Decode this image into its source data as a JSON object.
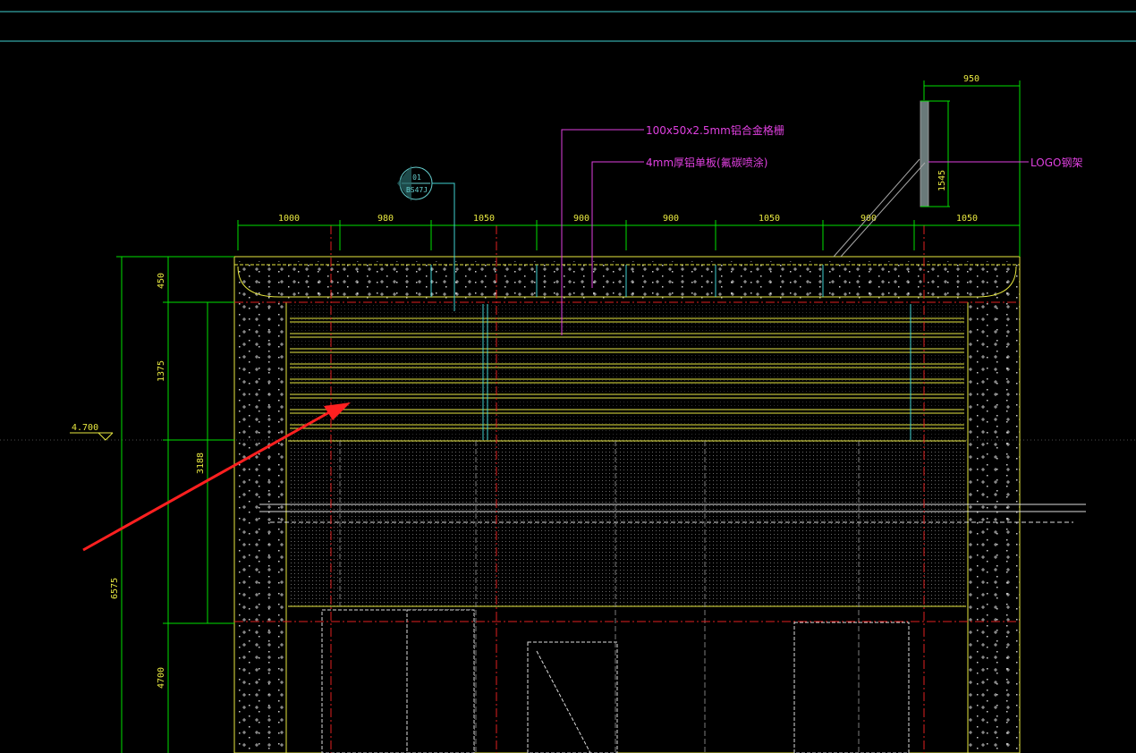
{
  "colors": {
    "background": "#000000",
    "dimension": "#00e000",
    "outline": "#e8e840",
    "leader": "#e040e0",
    "centerline": "#e02020",
    "cyan": "#40d0d0",
    "arrow": "#ff2020"
  },
  "top_dimensions": [
    "1000",
    "980",
    "1050",
    "900",
    "900",
    "1050",
    "900",
    "1050"
  ],
  "top_right_dimension": "950",
  "logo_height_dimension": "1545",
  "left_dimensions": [
    "450",
    "1375",
    "3188",
    "4700",
    "6575"
  ],
  "level_mark": "4.700",
  "detail_tag": {
    "top": "01",
    "bottom": "BS47J"
  },
  "notes": {
    "frame": "100x50x2.5mm铝合金格栅",
    "panel": "4mm厚铝单板(氟碳喷涂)",
    "logo": "LOGO钢架"
  }
}
